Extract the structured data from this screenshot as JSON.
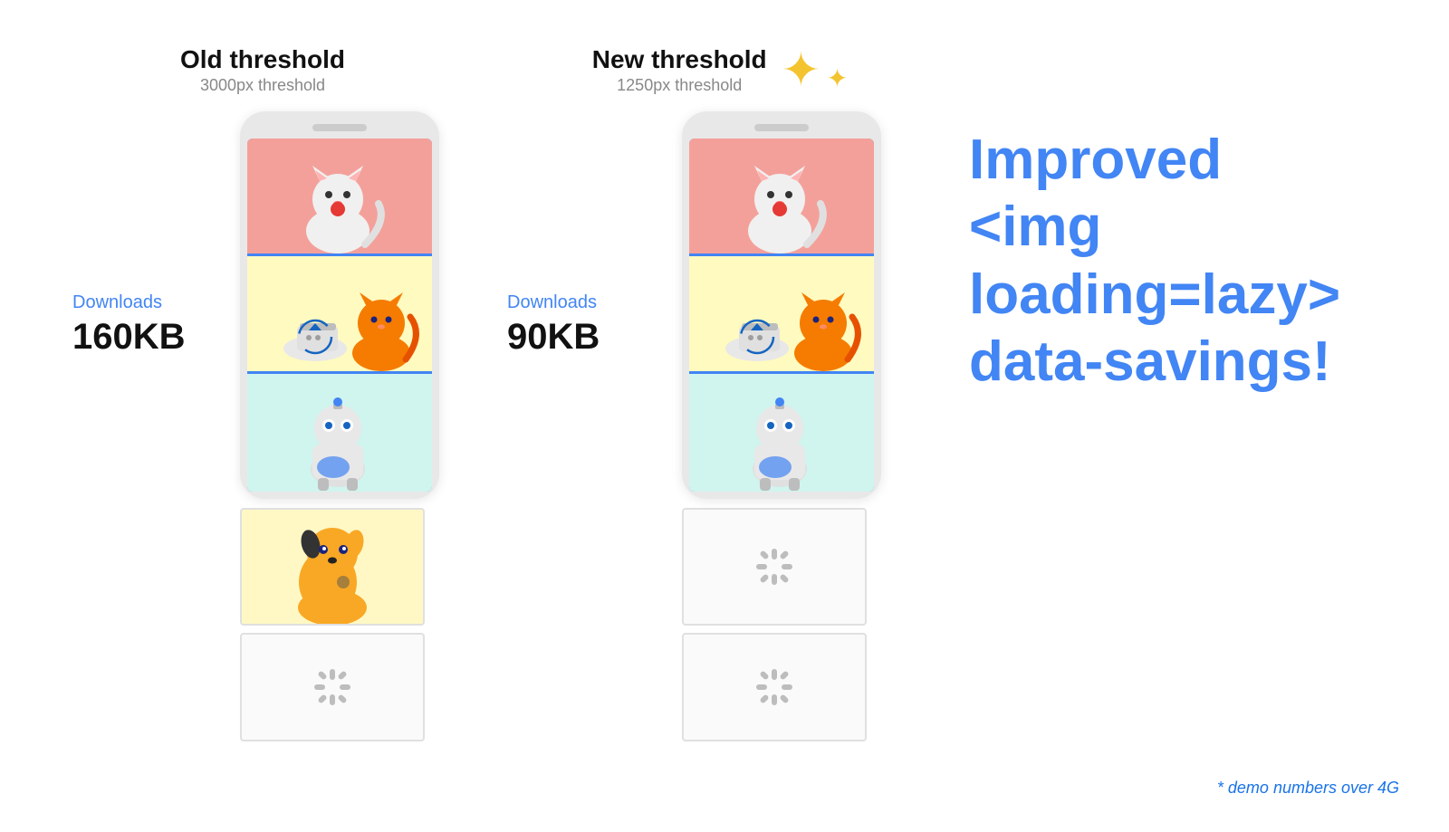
{
  "left": {
    "threshold_title": "Old threshold",
    "threshold_sub": "3000px threshold",
    "downloads_label": "Downloads",
    "downloads_size": "160KB"
  },
  "right": {
    "threshold_title": "New threshold",
    "threshold_sub": "1250px threshold",
    "downloads_label": "Downloads",
    "downloads_size": "90KB"
  },
  "main_text": {
    "line1": "Improved",
    "line2": "<img loading=lazy>",
    "line3": "data-savings!"
  },
  "demo_note": "* demo numbers over 4G",
  "sparkle": "✦"
}
